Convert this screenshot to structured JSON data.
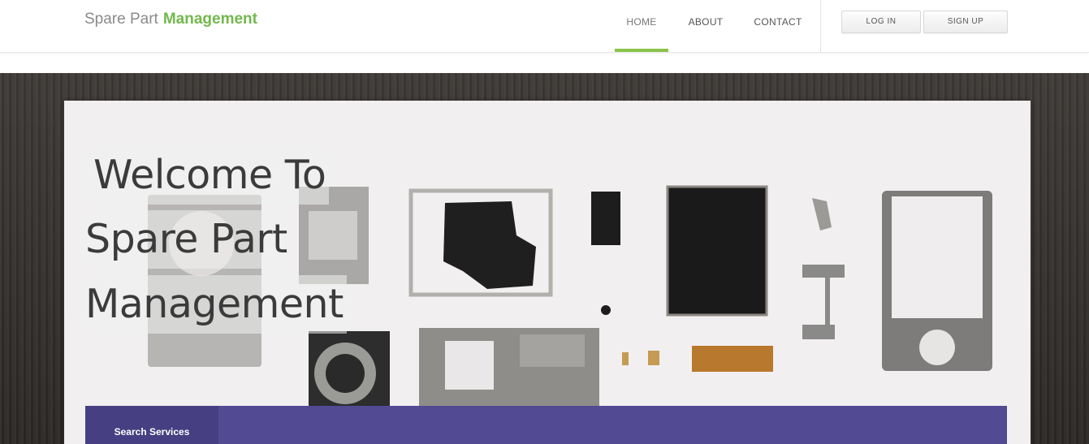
{
  "brand": {
    "light": "Spare Part",
    "strong": "Management"
  },
  "nav": [
    {
      "label": "HOME",
      "active": true
    },
    {
      "label": "ABOUT",
      "active": false
    },
    {
      "label": "CONTACT",
      "active": false
    }
  ],
  "auth": {
    "login": "LOG IN",
    "signup": "SIGN UP"
  },
  "hero": {
    "lines": [
      "Welcome To",
      "Spare Part",
      "Management"
    ]
  },
  "search": {
    "tab_label": "Search Services"
  },
  "colors": {
    "accent_green": "#8bc34a",
    "brand_green": "#72b84c",
    "search_purple": "#524a93",
    "search_tab_purple": "#463f82"
  }
}
